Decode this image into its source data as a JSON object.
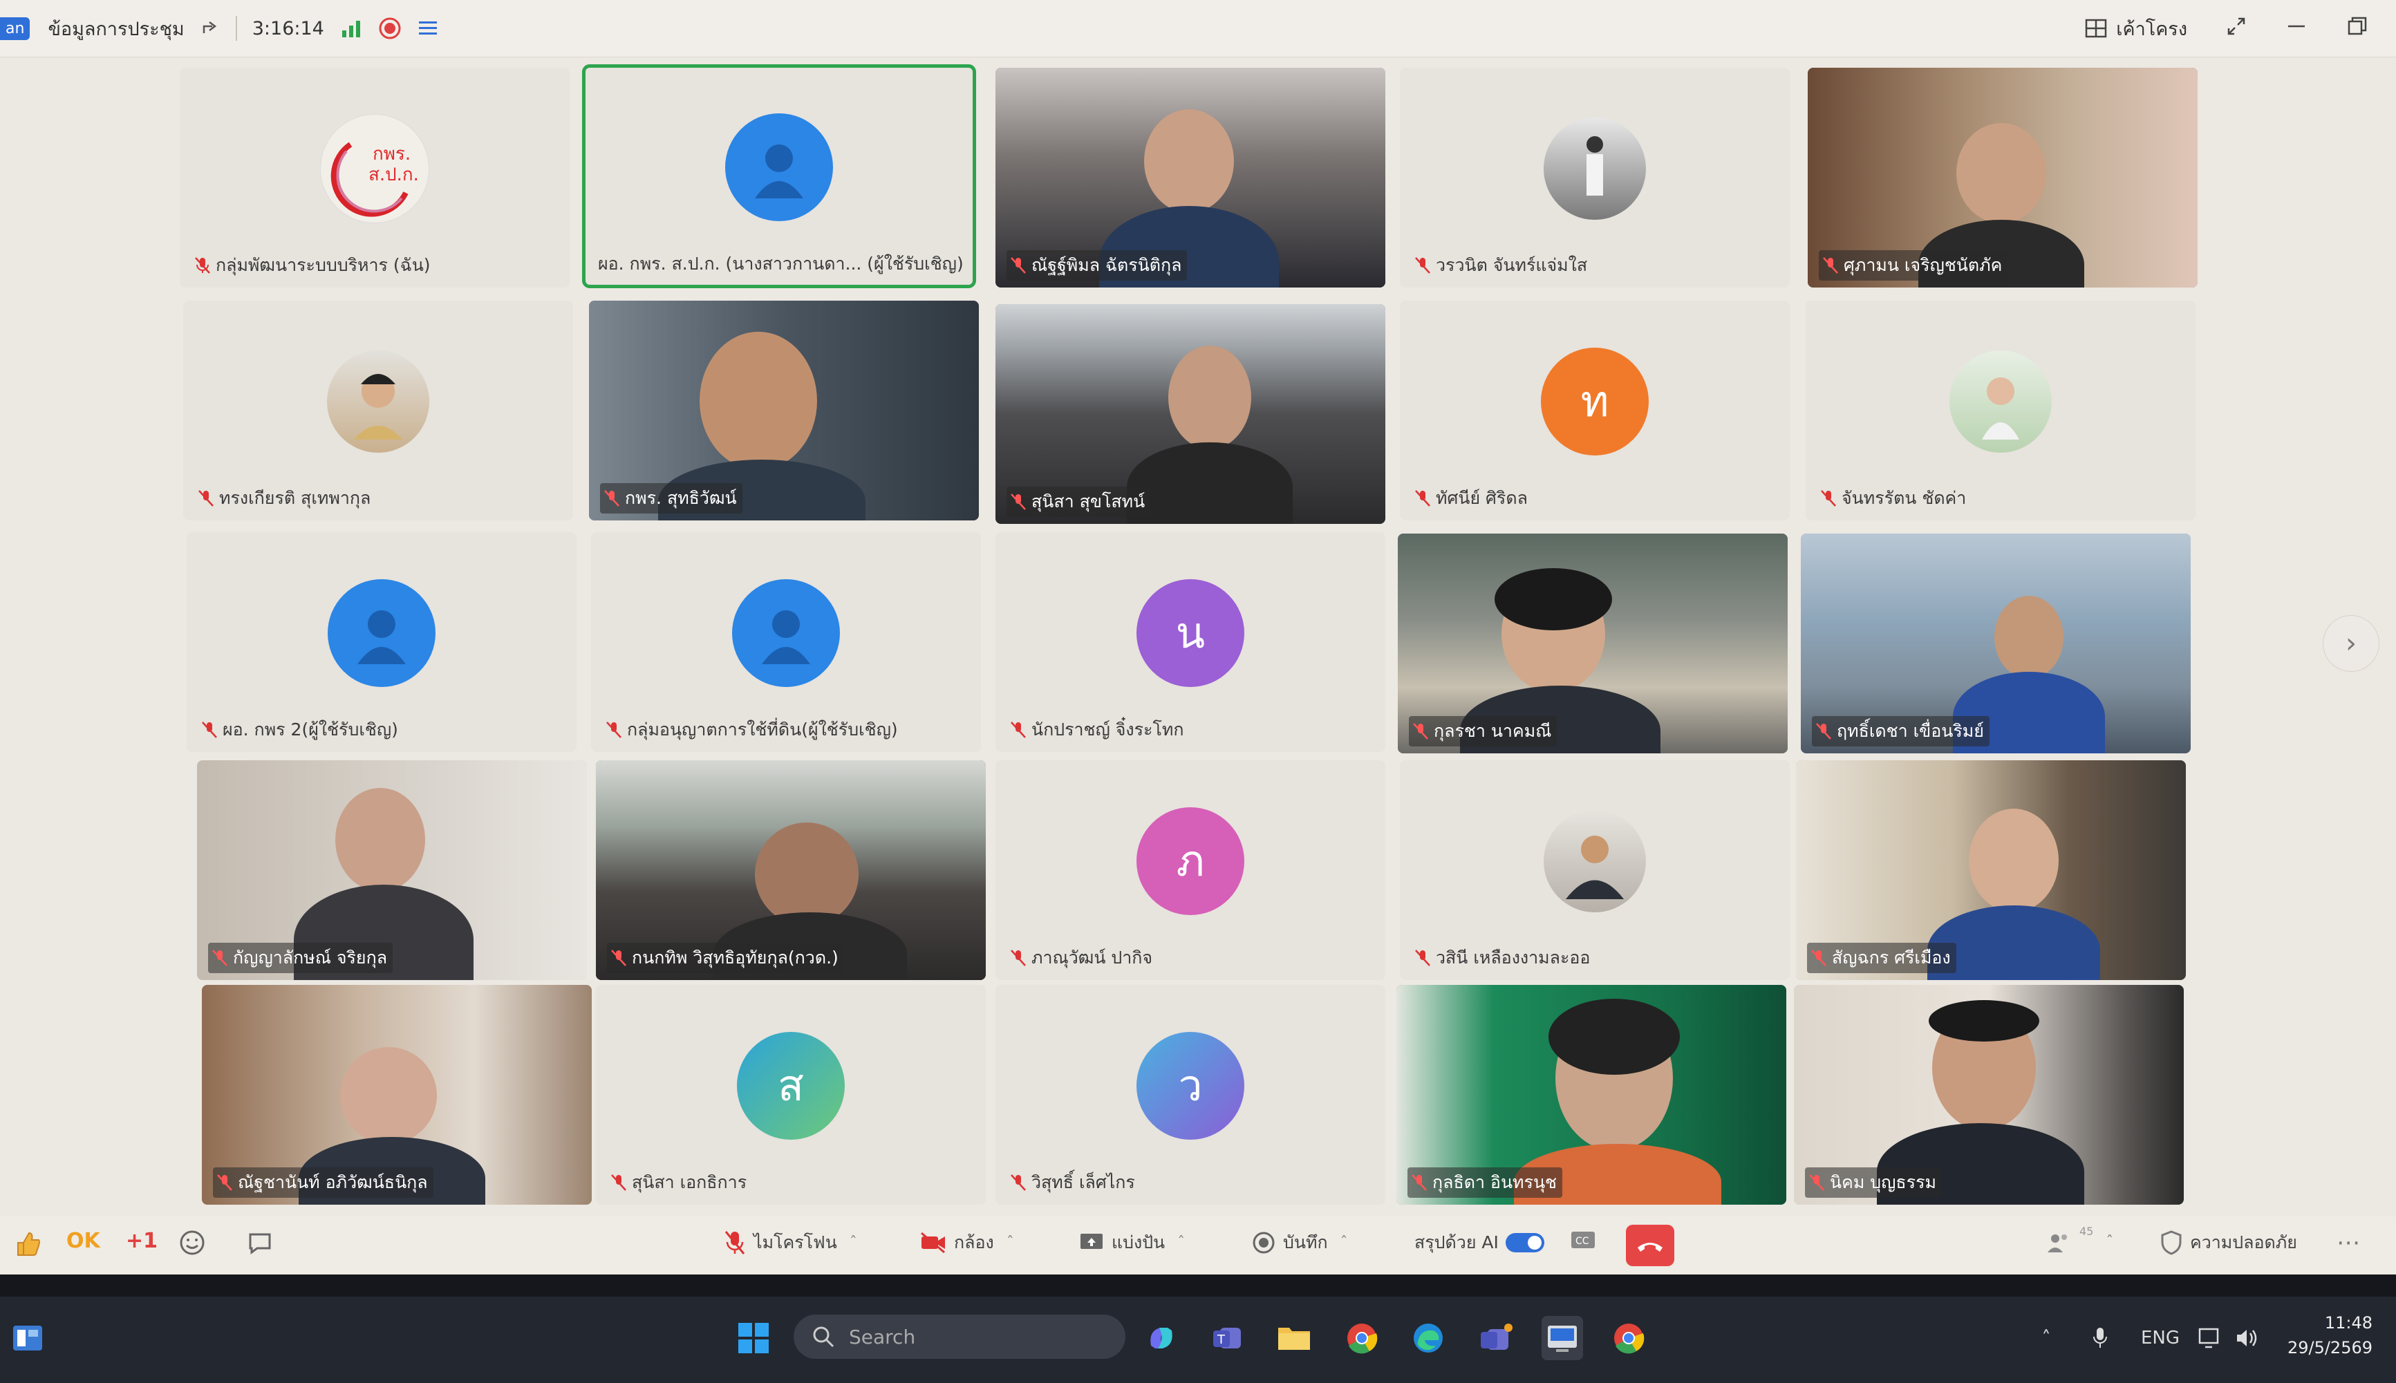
{
  "topbar": {
    "app_chip": "an",
    "meeting_info_label": "ข้อมูลการประชุม",
    "timer": "3:16:14",
    "layout_label": "เค้าโครง"
  },
  "participants": [
    {
      "name": "กลุ่มพัฒนาระบบบริหาร (ฉัน)",
      "kind": "logo",
      "logo_text": [
        "กพร.",
        "ส.ป.ก."
      ]
    },
    {
      "name": "ผอ. กพร. ส.ป.ก. (นางสาวกานดา... (ผู้ใช้รับเชิญ)",
      "kind": "avatar",
      "color": "#2b86e6",
      "active": true
    },
    {
      "name": "ณัฐฐ์พิมล ฉัตรนิติกุล",
      "kind": "video"
    },
    {
      "name": "วรวนิต จันทร์แจ่มใส",
      "kind": "photo"
    },
    {
      "name": "ศุภามน เจริญชนัตภัค",
      "kind": "video"
    },
    {
      "name": "ทรงเกียรติ สุเทพากุล",
      "kind": "photo"
    },
    {
      "name": "กพร. สุทธิวัฒน์",
      "kind": "video"
    },
    {
      "name": "สุนิสา สุขโสทน์",
      "kind": "video"
    },
    {
      "name": "ทัศนีย์ ศิริดล",
      "kind": "avatar",
      "letter": "ท",
      "color": "#f07a2a"
    },
    {
      "name": "จันทรรัตน ชัดค่า",
      "kind": "photo"
    },
    {
      "name": "ผอ. กพร 2(ผู้ใช้รับเชิญ)",
      "kind": "avatar",
      "color": "#2b86e6"
    },
    {
      "name": "กลุ่มอนุญาตการใช้ที่ดิน(ผู้ใช้รับเชิญ)",
      "kind": "avatar",
      "color": "#2b86e6"
    },
    {
      "name": "นักปราชญ์ จิ๋งระโทก",
      "kind": "avatar",
      "letter": "น",
      "color": "#9b5fd6"
    },
    {
      "name": "กุลรชา นาคมณี",
      "kind": "video"
    },
    {
      "name": "ฤทธิ์เดชา เขื่อนริมย์",
      "kind": "video"
    },
    {
      "name": "กัญญาลักษณ์ จริยกุล",
      "kind": "video"
    },
    {
      "name": "กนกทิพ วิสุทธิอุทัยกุล(กวด.)",
      "kind": "video"
    },
    {
      "name": "ภาณุวัฒน์ ปากิจ",
      "kind": "avatar",
      "letter": "ภ",
      "color": "#d65fb8"
    },
    {
      "name": "วสินี เหลืองงามละออ",
      "kind": "photo"
    },
    {
      "name": "สัญฉกร ศรีเมือง",
      "kind": "video"
    },
    {
      "name": "ณัฐชานันท์ อภิวัฒน์ธนิกุล",
      "kind": "video"
    },
    {
      "name": "สุนิสา เอกธิการ",
      "kind": "avatar",
      "letter": "ส",
      "color": "#33a0c8"
    },
    {
      "name": "วิสุทธิ์ เล็ศไกร",
      "kind": "avatar",
      "letter": "ว",
      "color": "#5a7ee0"
    },
    {
      "name": "กุลธิดา อินทรนุช",
      "kind": "video"
    },
    {
      "name": "นิคม บุญธรรม",
      "kind": "video"
    }
  ],
  "reactions": {
    "ok": "OK",
    "plus_one": "+1"
  },
  "controls": {
    "microphone": "ไมโครโฟน",
    "camera": "กล้อง",
    "share": "แบ่งปัน",
    "record": "บันทึก",
    "ai_summary": "สรุปด้วย AI",
    "security": "ความปลอดภัย",
    "participant_count": "45"
  },
  "taskbar": {
    "search_placeholder": "Search",
    "language": "ENG",
    "time": "11:48",
    "date": "29/5/2569"
  }
}
